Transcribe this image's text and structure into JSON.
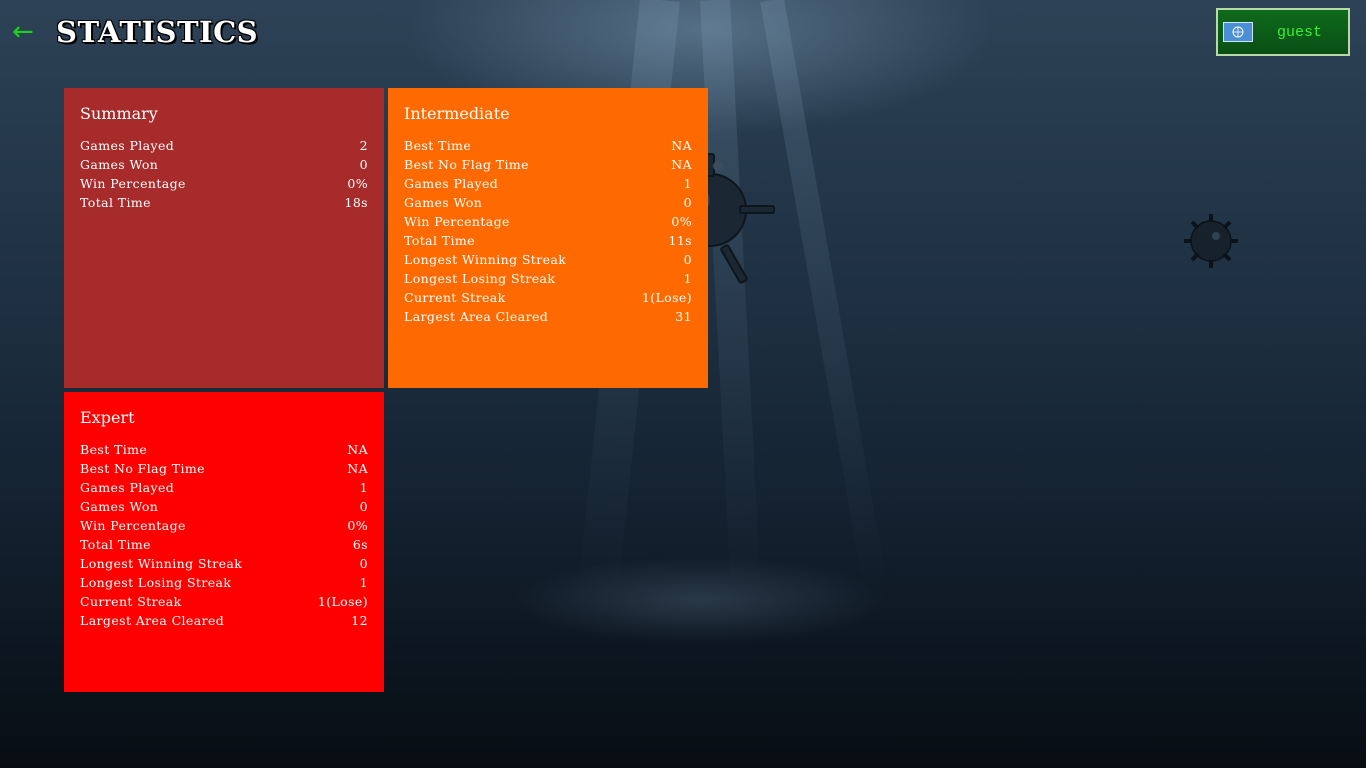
{
  "header": {
    "back_icon": "left-arrow-icon",
    "title": "STATISTICS"
  },
  "user": {
    "flag_icon": "un-flag-icon",
    "name": "guest"
  },
  "colors": {
    "summary": "#a72b2b",
    "intermediate": "#ff6a00",
    "expert": "#ff0000",
    "accent_green": "#1fd11f"
  },
  "panels": {
    "summary": {
      "title": "Summary",
      "rows": [
        {
          "label": "Games Played",
          "value": "2"
        },
        {
          "label": "Games Won",
          "value": "0"
        },
        {
          "label": "Win Percentage",
          "value": "0%"
        },
        {
          "label": "Total Time",
          "value": "18s"
        }
      ]
    },
    "intermediate": {
      "title": "Intermediate",
      "rows": [
        {
          "label": "Best Time",
          "value": "NA"
        },
        {
          "label": "Best No Flag Time",
          "value": "NA"
        },
        {
          "label": "Games Played",
          "value": "1"
        },
        {
          "label": "Games Won",
          "value": "0"
        },
        {
          "label": "Win Percentage",
          "value": "0%"
        },
        {
          "label": "Total Time",
          "value": "11s"
        },
        {
          "label": "Longest Winning Streak",
          "value": "0"
        },
        {
          "label": "Longest Losing Streak",
          "value": "1"
        },
        {
          "label": "Current Streak",
          "value": "1(Lose)"
        },
        {
          "label": "Largest Area Cleared",
          "value": "31"
        }
      ]
    },
    "expert": {
      "title": "Expert",
      "rows": [
        {
          "label": "Best Time",
          "value": "NA"
        },
        {
          "label": "Best No Flag Time",
          "value": "NA"
        },
        {
          "label": "Games Played",
          "value": "1"
        },
        {
          "label": "Games Won",
          "value": "0"
        },
        {
          "label": "Win Percentage",
          "value": "0%"
        },
        {
          "label": "Total Time",
          "value": "6s"
        },
        {
          "label": "Longest Winning Streak",
          "value": "0"
        },
        {
          "label": "Longest Losing Streak",
          "value": "1"
        },
        {
          "label": "Current Streak",
          "value": "1(Lose)"
        },
        {
          "label": "Largest Area Cleared",
          "value": "12"
        }
      ]
    }
  }
}
